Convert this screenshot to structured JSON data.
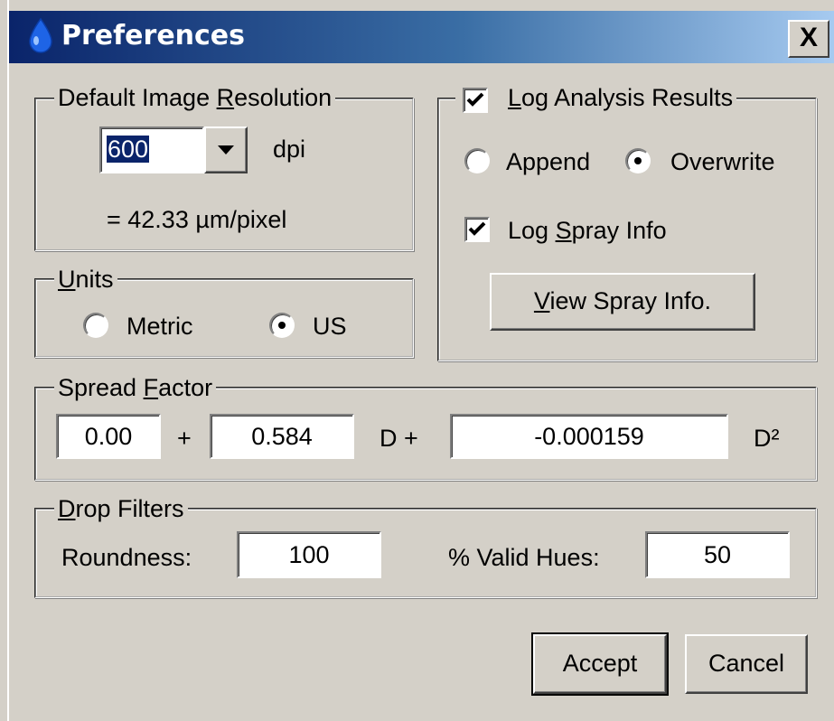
{
  "window": {
    "title": "Preferences",
    "close_label": "X"
  },
  "resolution": {
    "group_label_pre": "Default Image ",
    "group_label_ul": "R",
    "group_label_post": "esolution",
    "dpi_value": "600",
    "dpi_unit": "dpi",
    "conversion": "= 42.33 µm/pixel"
  },
  "units": {
    "group_label_ul": "U",
    "group_label_post": "nits",
    "metric_label": "Metric",
    "us_label": "US",
    "selected": "US"
  },
  "log": {
    "group_label_ul": "L",
    "group_label_post": "og Analysis Results",
    "log_checked": true,
    "append_label": "Append",
    "overwrite_label": "Overwrite",
    "mode_selected": "Overwrite",
    "spray_pre": "Log ",
    "spray_ul": "S",
    "spray_post": "pray Info",
    "spray_checked": true,
    "view_ul": "V",
    "view_post": "iew Spray Info."
  },
  "spread": {
    "group_label_pre": "Spread ",
    "group_label_ul": "F",
    "group_label_post": "actor",
    "c0": "0.00",
    "plus": "+",
    "c1": "0.584",
    "d_plus": "D +",
    "c2": "-0.000159",
    "d2": "D²"
  },
  "filters": {
    "group_label_ul": "D",
    "group_label_post": "rop Filters",
    "roundness_label": "Roundness:",
    "roundness_value": "100",
    "valid_hues_label": "% Valid Hues:",
    "valid_hues_value": "50"
  },
  "buttons": {
    "accept": "Accept",
    "cancel": "Cancel"
  },
  "colors": {
    "title_gradient_start": "#0a246a",
    "title_gradient_end": "#a6caf0",
    "face": "#d4d0c8",
    "selection": "#0a246a",
    "drop_icon": "#1e64e6"
  }
}
